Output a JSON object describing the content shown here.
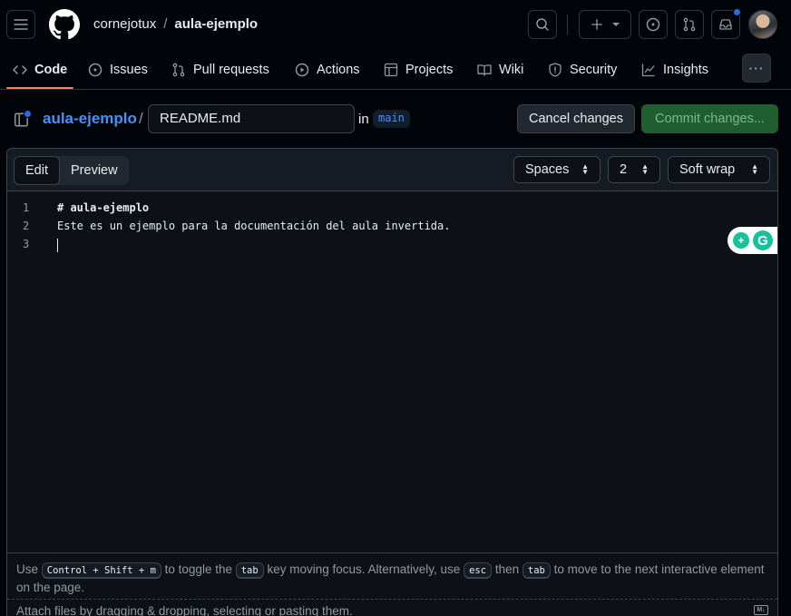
{
  "header": {
    "owner": "cornejotux",
    "separator": "/",
    "repo": "aula-ejemplo"
  },
  "nav": {
    "items": [
      {
        "label": "Code",
        "icon": "code-icon",
        "active": true
      },
      {
        "label": "Issues",
        "icon": "issue-icon"
      },
      {
        "label": "Pull requests",
        "icon": "pull-request-icon"
      },
      {
        "label": "Actions",
        "icon": "actions-icon"
      },
      {
        "label": "Projects",
        "icon": "projects-icon"
      },
      {
        "label": "Wiki",
        "icon": "wiki-icon"
      },
      {
        "label": "Security",
        "icon": "shield-icon"
      },
      {
        "label": "Insights",
        "icon": "graph-icon"
      }
    ],
    "more": "···"
  },
  "file": {
    "repo_link": "aula-ejemplo",
    "separator": "/",
    "filename": "README.md",
    "in_label": "in",
    "branch": "main",
    "cancel_label": "Cancel changes",
    "commit_label": "Commit changes..."
  },
  "editor": {
    "tabs": {
      "edit": "Edit",
      "preview": "Preview"
    },
    "indent_mode": "Spaces",
    "indent_size": "2",
    "wrap_mode": "Soft wrap",
    "lines": [
      {
        "number": "1",
        "text": "# aula-ejemplo"
      },
      {
        "number": "2",
        "text": "Este es un ejemplo para la documentación del aula invertida."
      },
      {
        "number": "3",
        "text": ""
      }
    ]
  },
  "footer": {
    "hint_use": "Use",
    "kbd_toggle": "Control + Shift + m",
    "hint_toggle": "to toggle the",
    "kbd_tab": "tab",
    "hint_focus": "key moving focus. Alternatively, use",
    "kbd_esc": "esc",
    "hint_then": "then",
    "kbd_tab2": "tab",
    "hint_next": "to move to the next interactive element on the page.",
    "attach": "Attach files by dragging & dropping, selecting or pasting them.",
    "md_badge": "M↓"
  },
  "colors": {
    "accent_link": "#4493f8",
    "commit_green": "#1f5f2f",
    "active_underline": "#f78166"
  }
}
